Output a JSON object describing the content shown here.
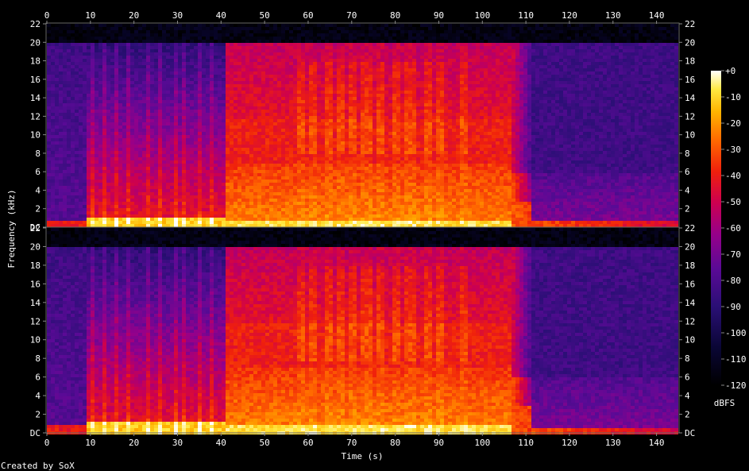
{
  "chart_data": {
    "type": "heatmap",
    "title": "",
    "xlabel": "Time (s)",
    "ylabel": "Frequency (kHz)",
    "x_ticks": [
      "0",
      "10",
      "20",
      "30",
      "40",
      "50",
      "60",
      "70",
      "80",
      "90",
      "100",
      "110",
      "120",
      "130",
      "140"
    ],
    "xlim": [
      0,
      145
    ],
    "channels": [
      {
        "y_ticks_left": [
          "DC",
          "2",
          "4",
          "6",
          "8",
          "10",
          "12",
          "14",
          "16",
          "18",
          "20",
          "22"
        ],
        "y_ticks_right": [
          "2",
          "4",
          "6",
          "8",
          "10",
          "12",
          "14",
          "16",
          "18",
          "20",
          "22"
        ],
        "ylim_khz": [
          0,
          22
        ]
      },
      {
        "y_ticks_left": [
          "DC",
          "2",
          "4",
          "6",
          "8",
          "10",
          "12",
          "14",
          "16",
          "18",
          "20",
          "22"
        ],
        "y_ticks_right": [
          "DC",
          "2",
          "4",
          "6",
          "8",
          "10",
          "12",
          "14",
          "16",
          "18",
          "20",
          "22"
        ],
        "ylim_khz": [
          0,
          22
        ]
      }
    ],
    "colorbar": {
      "label": "dBFS",
      "ticks": [
        "+0",
        "-10",
        "-20",
        "-30",
        "-40",
        "-50",
        "-60",
        "-70",
        "-80",
        "-90",
        "-100",
        "-110",
        "-120"
      ],
      "range_db": [
        -120,
        0
      ]
    },
    "segments": [
      {
        "t_start": 0,
        "t_end": 9,
        "level": "quiet intro, low-frequency energy"
      },
      {
        "t_start": 9,
        "t_end": 41,
        "level": "loud, vertical transient streaks"
      },
      {
        "t_start": 41,
        "t_end": 106,
        "level": "loudest, full-band to 20 kHz"
      },
      {
        "t_start": 106,
        "t_end": 111,
        "level": "high-frequency roll-off"
      },
      {
        "t_start": 111,
        "t_end": 145,
        "level": "fade-out, energy below 6 kHz"
      }
    ]
  },
  "footer": {
    "credit": "Created by SoX"
  }
}
